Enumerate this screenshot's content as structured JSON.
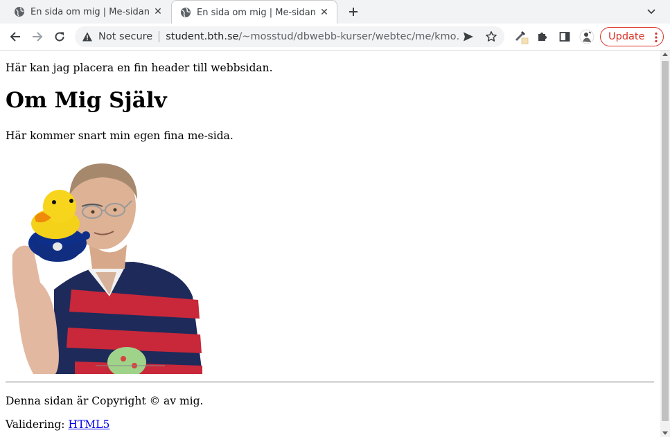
{
  "tabs": [
    {
      "title": "En sida om mig | Me-sidan",
      "active": false
    },
    {
      "title": "En sida om mig | Me-sidan",
      "active": true
    }
  ],
  "toolbar": {
    "security_label": "Not secure",
    "url_host": "student.bth.se",
    "url_path": "/~mosstud/dbwebb-kurser/webtec/me/kmo…",
    "update_label": "Update"
  },
  "page": {
    "header_text": "Här kan jag placera en fin header till webbsidan.",
    "heading": "Om Mig Själv",
    "intro_text": "Här kommer snart min egen fina me-sida.",
    "copyright_text": "Denna sidan är Copyright © av mig.",
    "validation_label": "Validering: ",
    "validation_link": "HTML5"
  },
  "colors": {
    "update_accent": "#d93025",
    "link": "#0000ee"
  },
  "icons": [
    "globe-icon",
    "close-icon",
    "plus-icon",
    "chevron-down-icon",
    "back-arrow-icon",
    "forward-arrow-icon",
    "reload-icon",
    "warning-icon",
    "send-icon",
    "star-icon",
    "eyedropper-icon",
    "puzzle-icon",
    "side-panel-icon",
    "avatar",
    "more-vert-icon"
  ]
}
